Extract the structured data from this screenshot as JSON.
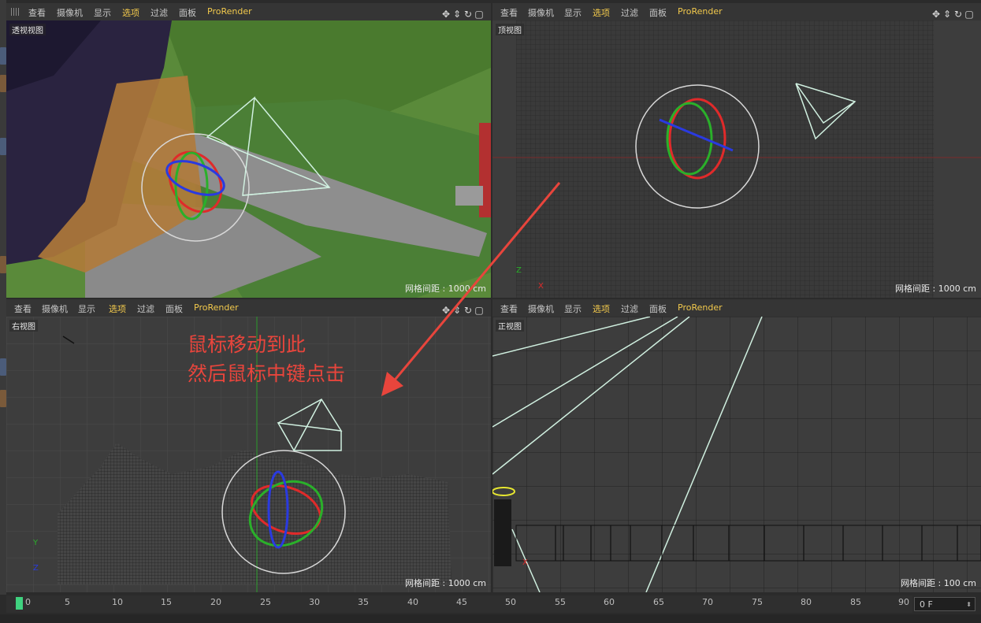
{
  "menu": {
    "items": [
      "查看",
      "摄像机",
      "显示",
      "选项",
      "过滤",
      "面板",
      "ProRender"
    ],
    "active_index": 3
  },
  "viewports": {
    "perspective": {
      "label": "透视视图",
      "grid": "网格间距 : 1000 cm"
    },
    "top": {
      "label": "顶视图",
      "grid": "网格间距 : 1000 cm"
    },
    "right": {
      "label": "右视图",
      "grid": "网格间距 : 1000 cm"
    },
    "front": {
      "label": "正视图",
      "grid": "网格间距 : 100 cm"
    }
  },
  "annotation": {
    "line1": "鼠标移动到此",
    "line2": "然后鼠标中键点击",
    "color": "#e8453c"
  },
  "timeline": {
    "ticks": [
      "0",
      "5",
      "10",
      "15",
      "20",
      "25",
      "30",
      "35",
      "40",
      "45",
      "50",
      "55",
      "60",
      "65",
      "70",
      "75",
      "80",
      "85",
      "90"
    ],
    "current_frame": "0",
    "frame_field": "0 F"
  },
  "colors": {
    "active_menu": "#f2c94c",
    "accent": "#e8453c"
  }
}
